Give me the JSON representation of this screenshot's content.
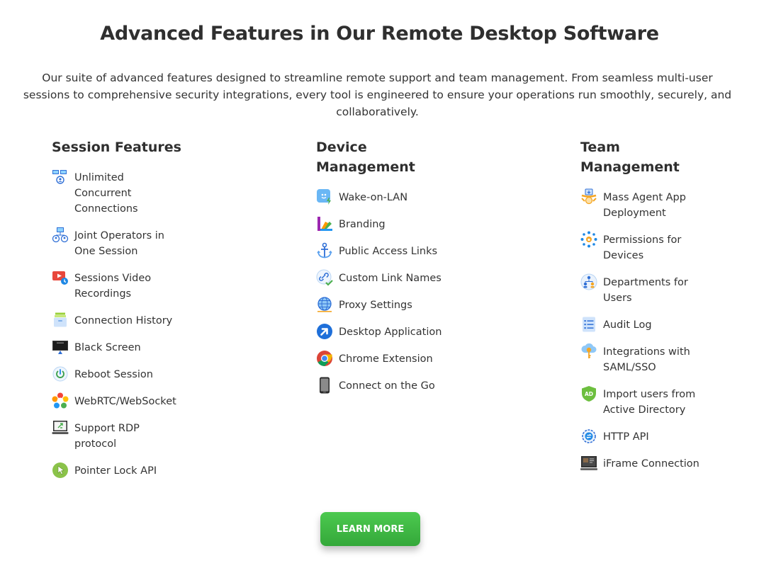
{
  "header": {
    "title": "Advanced Features in Our Remote Desktop Software",
    "subtitle": "Our suite of advanced features designed to streamline remote support and team management. From seamless multi-user sessions to comprehensive security integrations, every tool is engineered to ensure your operations run smoothly, securely, and collaboratively."
  },
  "columns": [
    {
      "heading": "Session Features",
      "items": [
        {
          "label": "Unlimited Concurrent Connections",
          "icon": "multi-monitor-users-icon"
        },
        {
          "label": "Joint Operators in One Session",
          "icon": "shared-session-icon"
        },
        {
          "label": "Sessions Video Recordings",
          "icon": "video-recording-icon"
        },
        {
          "label": "Connection History",
          "icon": "history-archive-icon"
        },
        {
          "label": "Black Screen",
          "icon": "black-screen-icon"
        },
        {
          "label": "Reboot Session",
          "icon": "power-icon"
        },
        {
          "label": "WebRTC/WebSocket",
          "icon": "webrtc-icon"
        },
        {
          "label": "Support RDP protocol",
          "icon": "rdp-icon"
        },
        {
          "label": "Pointer Lock API",
          "icon": "pointer-lock-icon"
        }
      ]
    },
    {
      "heading": "Device Management",
      "items": [
        {
          "label": "Wake-on-LAN",
          "icon": "wake-on-lan-icon"
        },
        {
          "label": "Branding",
          "icon": "branding-icon"
        },
        {
          "label": "Public Access Links",
          "icon": "anchor-icon"
        },
        {
          "label": "Custom Link Names",
          "icon": "link-check-icon"
        },
        {
          "label": "Proxy Settings",
          "icon": "globe-icon"
        },
        {
          "label": "Desktop Application",
          "icon": "desktop-app-arrow-icon"
        },
        {
          "label": "Chrome Extension",
          "icon": "chrome-icon"
        },
        {
          "label": "Connect on the Go",
          "icon": "phone-icon"
        }
      ]
    },
    {
      "heading": "Team Management",
      "items": [
        {
          "label": "Mass Agent App Deployment",
          "icon": "mass-deployment-icon"
        },
        {
          "label": "Permissions for Devices",
          "icon": "permissions-icon"
        },
        {
          "label": "Departments for Users",
          "icon": "departments-icon"
        },
        {
          "label": "Audit Log",
          "icon": "audit-log-icon"
        },
        {
          "label": "Integrations with SAML/SSO",
          "icon": "saml-key-icon"
        },
        {
          "label": "Import users from Active Directory",
          "icon": "active-directory-icon"
        },
        {
          "label": "HTTP API",
          "icon": "http-api-icon"
        },
        {
          "label": "iFrame Connection",
          "icon": "iframe-icon"
        }
      ]
    }
  ],
  "cta": {
    "label": "LEARN MORE"
  },
  "colors": {
    "accent": "#3cb043",
    "text": "#333333"
  }
}
